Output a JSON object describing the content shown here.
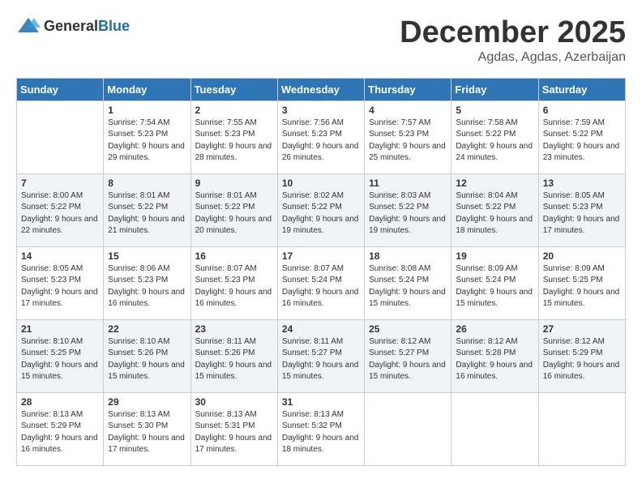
{
  "logo": {
    "text_general": "General",
    "text_blue": "Blue"
  },
  "title": {
    "month": "December 2025",
    "location": "Agdas, Agdas, Azerbaijan"
  },
  "calendar": {
    "headers": [
      "Sunday",
      "Monday",
      "Tuesday",
      "Wednesday",
      "Thursday",
      "Friday",
      "Saturday"
    ],
    "weeks": [
      [
        {
          "day": "",
          "sunrise": "",
          "sunset": "",
          "daylight": "",
          "empty": true
        },
        {
          "day": "1",
          "sunrise": "Sunrise: 7:54 AM",
          "sunset": "Sunset: 5:23 PM",
          "daylight": "Daylight: 9 hours and 29 minutes."
        },
        {
          "day": "2",
          "sunrise": "Sunrise: 7:55 AM",
          "sunset": "Sunset: 5:23 PM",
          "daylight": "Daylight: 9 hours and 28 minutes."
        },
        {
          "day": "3",
          "sunrise": "Sunrise: 7:56 AM",
          "sunset": "Sunset: 5:23 PM",
          "daylight": "Daylight: 9 hours and 26 minutes."
        },
        {
          "day": "4",
          "sunrise": "Sunrise: 7:57 AM",
          "sunset": "Sunset: 5:23 PM",
          "daylight": "Daylight: 9 hours and 25 minutes."
        },
        {
          "day": "5",
          "sunrise": "Sunrise: 7:58 AM",
          "sunset": "Sunset: 5:22 PM",
          "daylight": "Daylight: 9 hours and 24 minutes."
        },
        {
          "day": "6",
          "sunrise": "Sunrise: 7:59 AM",
          "sunset": "Sunset: 5:22 PM",
          "daylight": "Daylight: 9 hours and 23 minutes."
        }
      ],
      [
        {
          "day": "7",
          "sunrise": "Sunrise: 8:00 AM",
          "sunset": "Sunset: 5:22 PM",
          "daylight": "Daylight: 9 hours and 22 minutes."
        },
        {
          "day": "8",
          "sunrise": "Sunrise: 8:01 AM",
          "sunset": "Sunset: 5:22 PM",
          "daylight": "Daylight: 9 hours and 21 minutes."
        },
        {
          "day": "9",
          "sunrise": "Sunrise: 8:01 AM",
          "sunset": "Sunset: 5:22 PM",
          "daylight": "Daylight: 9 hours and 20 minutes."
        },
        {
          "day": "10",
          "sunrise": "Sunrise: 8:02 AM",
          "sunset": "Sunset: 5:22 PM",
          "daylight": "Daylight: 9 hours and 19 minutes."
        },
        {
          "day": "11",
          "sunrise": "Sunrise: 8:03 AM",
          "sunset": "Sunset: 5:22 PM",
          "daylight": "Daylight: 9 hours and 19 minutes."
        },
        {
          "day": "12",
          "sunrise": "Sunrise: 8:04 AM",
          "sunset": "Sunset: 5:22 PM",
          "daylight": "Daylight: 9 hours and 18 minutes."
        },
        {
          "day": "13",
          "sunrise": "Sunrise: 8:05 AM",
          "sunset": "Sunset: 5:23 PM",
          "daylight": "Daylight: 9 hours and 17 minutes."
        }
      ],
      [
        {
          "day": "14",
          "sunrise": "Sunrise: 8:05 AM",
          "sunset": "Sunset: 5:23 PM",
          "daylight": "Daylight: 9 hours and 17 minutes."
        },
        {
          "day": "15",
          "sunrise": "Sunrise: 8:06 AM",
          "sunset": "Sunset: 5:23 PM",
          "daylight": "Daylight: 9 hours and 16 minutes."
        },
        {
          "day": "16",
          "sunrise": "Sunrise: 8:07 AM",
          "sunset": "Sunset: 5:23 PM",
          "daylight": "Daylight: 9 hours and 16 minutes."
        },
        {
          "day": "17",
          "sunrise": "Sunrise: 8:07 AM",
          "sunset": "Sunset: 5:24 PM",
          "daylight": "Daylight: 9 hours and 16 minutes."
        },
        {
          "day": "18",
          "sunrise": "Sunrise: 8:08 AM",
          "sunset": "Sunset: 5:24 PM",
          "daylight": "Daylight: 9 hours and 15 minutes."
        },
        {
          "day": "19",
          "sunrise": "Sunrise: 8:09 AM",
          "sunset": "Sunset: 5:24 PM",
          "daylight": "Daylight: 9 hours and 15 minutes."
        },
        {
          "day": "20",
          "sunrise": "Sunrise: 8:09 AM",
          "sunset": "Sunset: 5:25 PM",
          "daylight": "Daylight: 9 hours and 15 minutes."
        }
      ],
      [
        {
          "day": "21",
          "sunrise": "Sunrise: 8:10 AM",
          "sunset": "Sunset: 5:25 PM",
          "daylight": "Daylight: 9 hours and 15 minutes."
        },
        {
          "day": "22",
          "sunrise": "Sunrise: 8:10 AM",
          "sunset": "Sunset: 5:26 PM",
          "daylight": "Daylight: 9 hours and 15 minutes."
        },
        {
          "day": "23",
          "sunrise": "Sunrise: 8:11 AM",
          "sunset": "Sunset: 5:26 PM",
          "daylight": "Daylight: 9 hours and 15 minutes."
        },
        {
          "day": "24",
          "sunrise": "Sunrise: 8:11 AM",
          "sunset": "Sunset: 5:27 PM",
          "daylight": "Daylight: 9 hours and 15 minutes."
        },
        {
          "day": "25",
          "sunrise": "Sunrise: 8:12 AM",
          "sunset": "Sunset: 5:27 PM",
          "daylight": "Daylight: 9 hours and 15 minutes."
        },
        {
          "day": "26",
          "sunrise": "Sunrise: 8:12 AM",
          "sunset": "Sunset: 5:28 PM",
          "daylight": "Daylight: 9 hours and 16 minutes."
        },
        {
          "day": "27",
          "sunrise": "Sunrise: 8:12 AM",
          "sunset": "Sunset: 5:29 PM",
          "daylight": "Daylight: 9 hours and 16 minutes."
        }
      ],
      [
        {
          "day": "28",
          "sunrise": "Sunrise: 8:13 AM",
          "sunset": "Sunset: 5:29 PM",
          "daylight": "Daylight: 9 hours and 16 minutes."
        },
        {
          "day": "29",
          "sunrise": "Sunrise: 8:13 AM",
          "sunset": "Sunset: 5:30 PM",
          "daylight": "Daylight: 9 hours and 17 minutes."
        },
        {
          "day": "30",
          "sunrise": "Sunrise: 8:13 AM",
          "sunset": "Sunset: 5:31 PM",
          "daylight": "Daylight: 9 hours and 17 minutes."
        },
        {
          "day": "31",
          "sunrise": "Sunrise: 8:13 AM",
          "sunset": "Sunset: 5:32 PM",
          "daylight": "Daylight: 9 hours and 18 minutes."
        },
        {
          "day": "",
          "sunrise": "",
          "sunset": "",
          "daylight": "",
          "empty": true
        },
        {
          "day": "",
          "sunrise": "",
          "sunset": "",
          "daylight": "",
          "empty": true
        },
        {
          "day": "",
          "sunrise": "",
          "sunset": "",
          "daylight": "",
          "empty": true
        }
      ]
    ]
  }
}
